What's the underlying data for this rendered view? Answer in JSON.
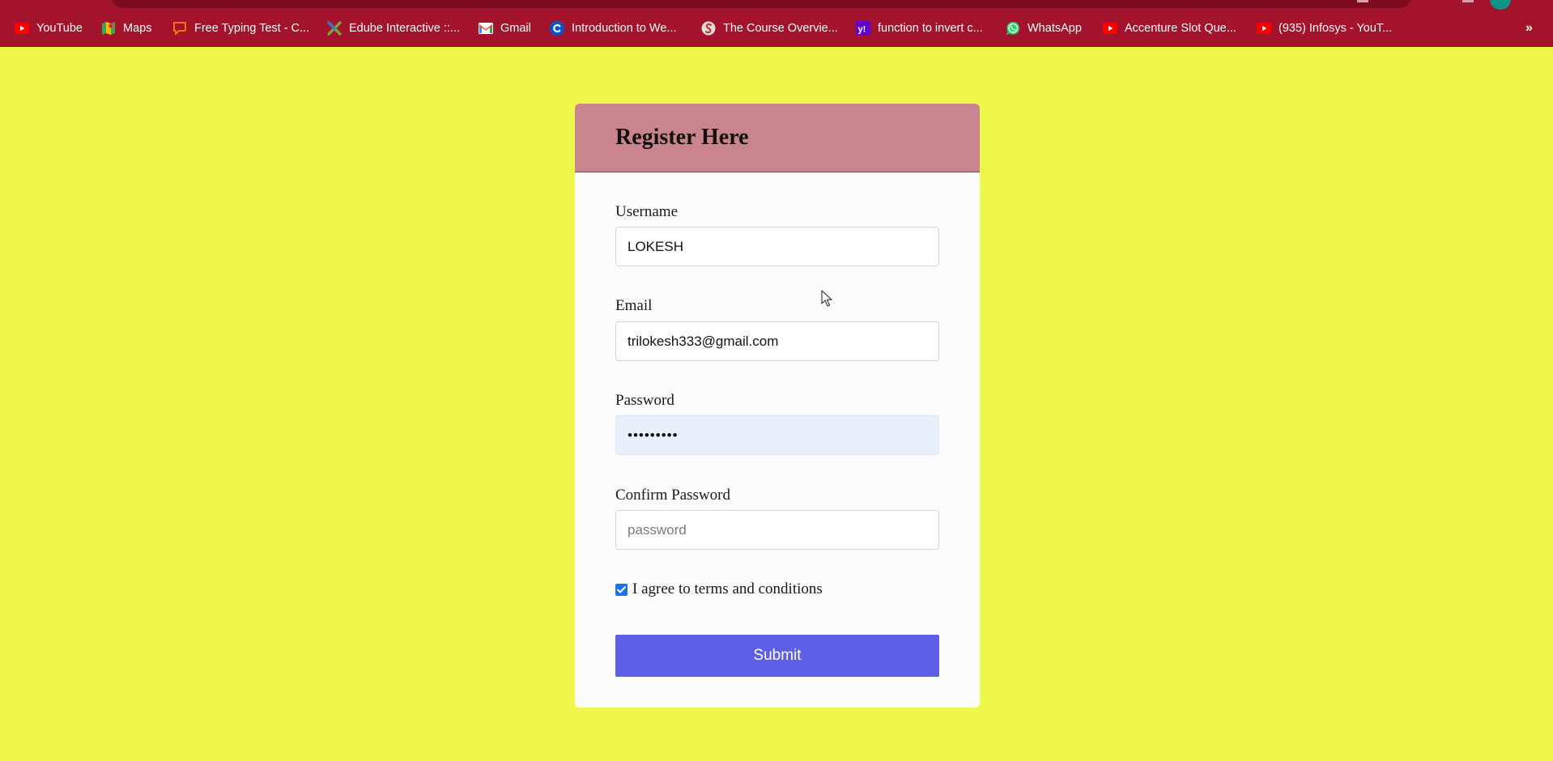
{
  "bookmarks": [
    {
      "label": "YouTube",
      "icon": "youtube-icon"
    },
    {
      "label": "Maps",
      "icon": "maps-icon"
    },
    {
      "label": "Free Typing Test - C...",
      "icon": "chat-bubble-icon"
    },
    {
      "label": "Edube Interactive ::...",
      "icon": "edube-icon"
    },
    {
      "label": "Gmail",
      "icon": "gmail-icon"
    },
    {
      "label": "Introduction to We...",
      "icon": "coursera-icon"
    },
    {
      "label": "The Course Overvie...",
      "icon": "globe-icon"
    },
    {
      "label": "function to invert c...",
      "icon": "yahoo-icon"
    },
    {
      "label": "WhatsApp",
      "icon": "whatsapp-icon"
    },
    {
      "label": "Accenture Slot Que...",
      "icon": "youtube-icon"
    },
    {
      "label": "(935) Infosys - YouT...",
      "icon": "youtube-icon"
    }
  ],
  "bookmarks_overflow": "»",
  "form": {
    "title": "Register Here",
    "username": {
      "label": "Username",
      "value": "LOKESH"
    },
    "email": {
      "label": "Email",
      "value": "trilokesh333@gmail.com"
    },
    "password": {
      "label": "Password",
      "value": "•••••••••"
    },
    "confirm_password": {
      "label": "Confirm Password",
      "placeholder": "password",
      "value": ""
    },
    "agree": {
      "label": "I agree to terms and conditions",
      "checked": true
    },
    "submit_label": "Submit"
  },
  "colors": {
    "page_background": "#edf84a",
    "bookmarks_bar": "#a4132c",
    "card_header": "#c9848e",
    "card_body": "#fbfbfb",
    "submit_button": "#5e5ee6",
    "autofill_background": "#e8f0fe"
  }
}
